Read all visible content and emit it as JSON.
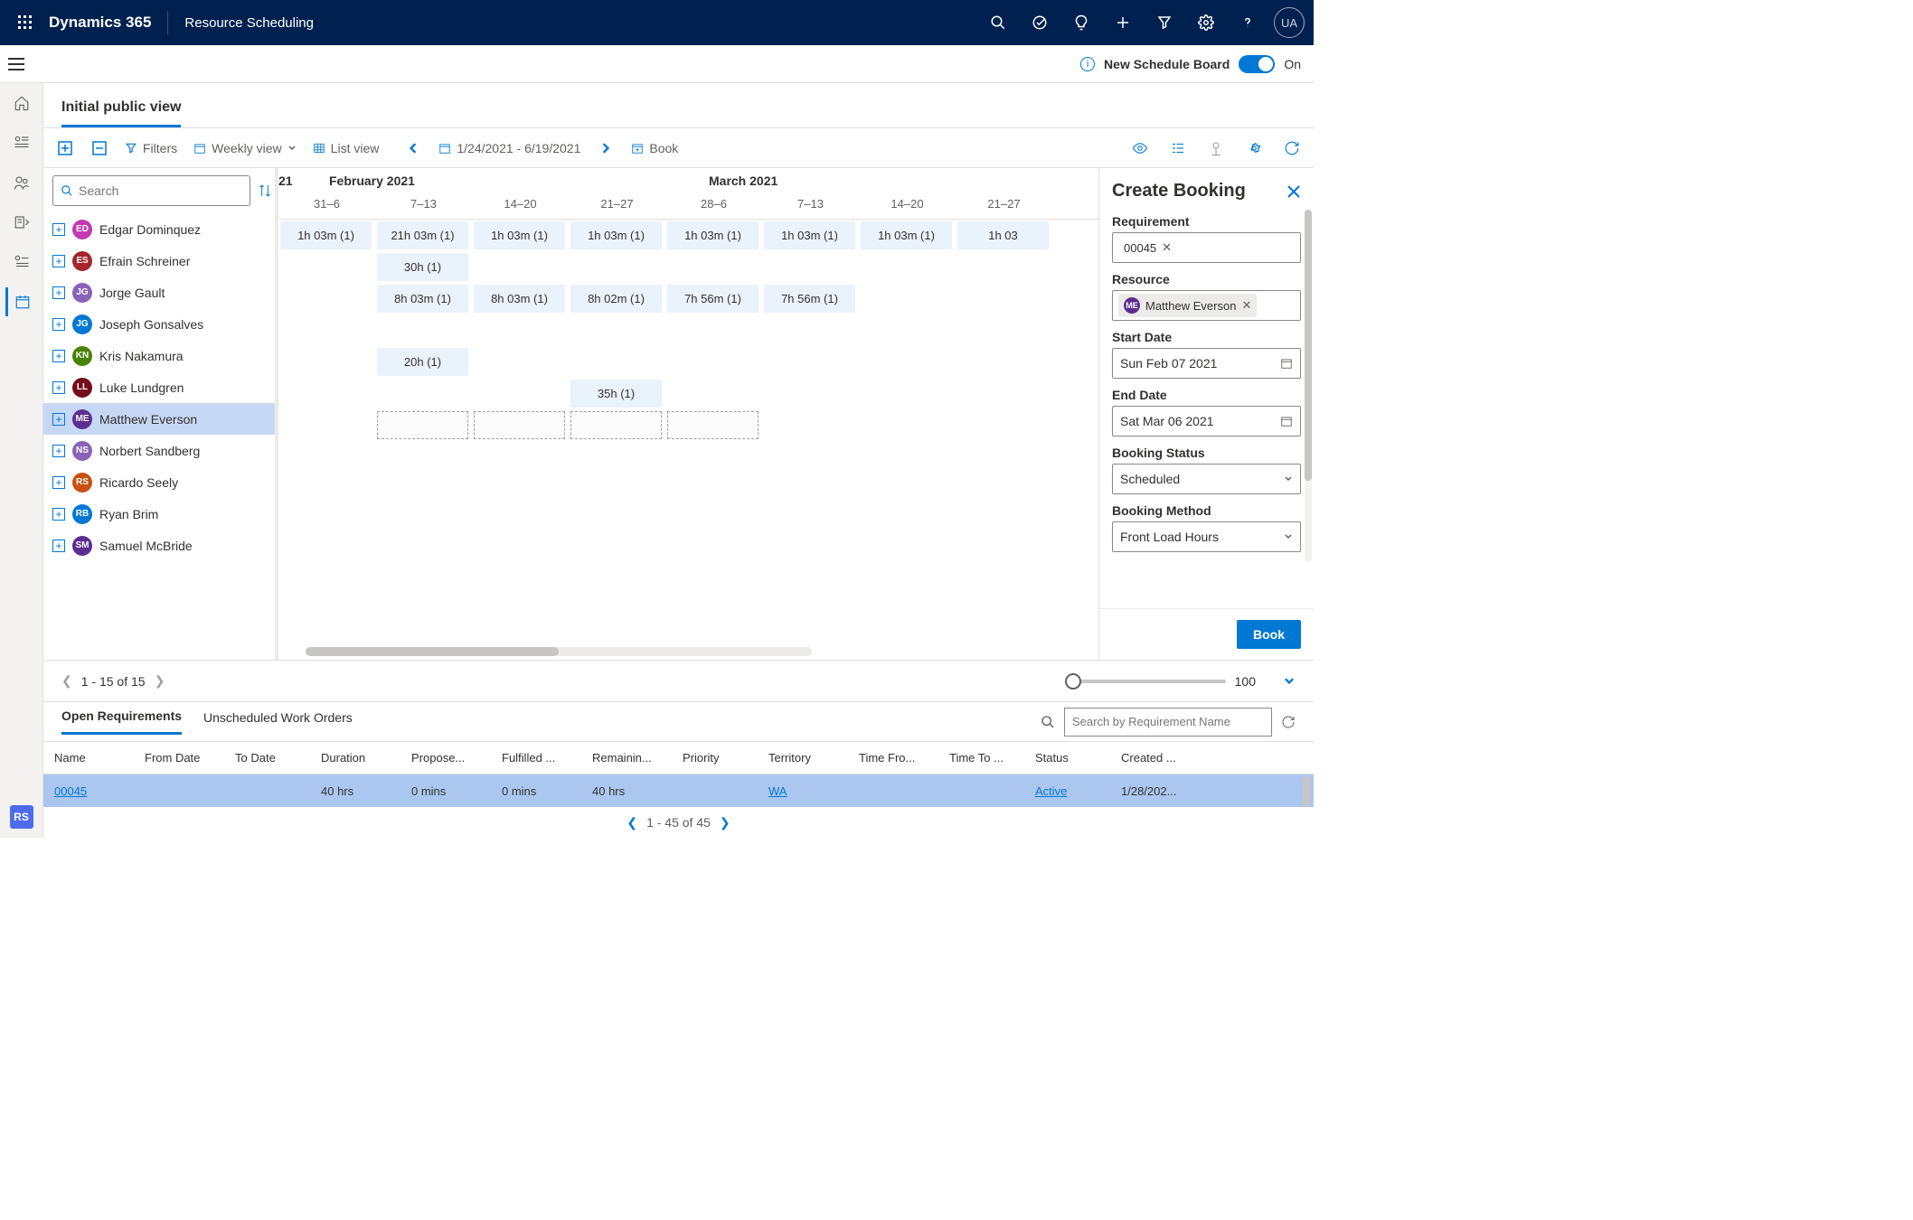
{
  "header": {
    "brand": "Dynamics 365",
    "module": "Resource Scheduling",
    "avatar": "UA"
  },
  "info_row": {
    "label": "New Schedule Board",
    "toggle_state": "On"
  },
  "view_tab": "Initial public view",
  "toolbar": {
    "filters": "Filters",
    "view_mode": "Weekly view",
    "list_view": "List view",
    "date_range": "1/24/2021 - 6/19/2021",
    "book": "Book"
  },
  "search": {
    "placeholder": "Search"
  },
  "resources": [
    {
      "initials": "ED",
      "color": "#c239b3",
      "name": "Edgar Dominquez"
    },
    {
      "initials": "ES",
      "color": "#a4262c",
      "name": "Efrain Schreiner"
    },
    {
      "initials": "JG",
      "color": "#8764b8",
      "name": "Jorge Gault"
    },
    {
      "initials": "JG",
      "color": "#0078d4",
      "name": "Joseph Gonsalves"
    },
    {
      "initials": "KN",
      "color": "#498205",
      "name": "Kris Nakamura"
    },
    {
      "initials": "LL",
      "color": "#750b1c",
      "name": "Luke Lundgren"
    },
    {
      "initials": "ME",
      "color": "#5c2e91",
      "name": "Matthew Everson",
      "selected": true
    },
    {
      "initials": "NS",
      "color": "#8764b8",
      "name": "Norbert Sandberg"
    },
    {
      "initials": "RS",
      "color": "#ca5010",
      "name": "Ricardo Seely"
    },
    {
      "initials": "RB",
      "color": "#0078d4",
      "name": "Ryan Brim"
    },
    {
      "initials": "SM",
      "color": "#5c2e91",
      "name": "Samuel McBride"
    }
  ],
  "timeline": {
    "prev_label": "21",
    "month1": "February 2021",
    "month2": "March 2021",
    "weeks": [
      "31–6",
      "7–13",
      "14–20",
      "21–27",
      "28–6",
      "7–13",
      "14–20",
      "21–27"
    ],
    "rows": [
      {
        "cells": [
          {
            "c": 0,
            "t": "1h 03m (1)"
          },
          {
            "c": 1,
            "t": "21h 03m (1)"
          },
          {
            "c": 2,
            "t": "1h 03m (1)"
          },
          {
            "c": 3,
            "t": "1h 03m (1)"
          },
          {
            "c": 4,
            "t": "1h 03m (1)"
          },
          {
            "c": 5,
            "t": "1h 03m (1)"
          },
          {
            "c": 6,
            "t": "1h 03m (1)"
          },
          {
            "c": 7,
            "t": "1h 03"
          }
        ]
      },
      {
        "cells": [
          {
            "c": 1,
            "t": "30h (1)"
          }
        ]
      },
      {
        "cells": [
          {
            "c": 1,
            "t": "8h 03m (1)"
          },
          {
            "c": 2,
            "t": "8h 03m (1)"
          },
          {
            "c": 3,
            "t": "8h 02m (1)"
          },
          {
            "c": 4,
            "t": "7h 56m (1)"
          },
          {
            "c": 5,
            "t": "7h 56m (1)"
          }
        ]
      },
      {
        "cells": []
      },
      {
        "cells": [
          {
            "c": 1,
            "t": "20h (1)"
          }
        ]
      },
      {
        "cells": [
          {
            "c": 3,
            "t": "35h (1)"
          }
        ]
      },
      {
        "cells": [],
        "dashed": true
      },
      {
        "cells": []
      },
      {
        "cells": []
      },
      {
        "cells": []
      },
      {
        "cells": []
      }
    ]
  },
  "panel": {
    "title": "Create Booking",
    "req_lbl": "Requirement",
    "req_val": "00045",
    "res_lbl": "Resource",
    "res_val": "Matthew Everson",
    "res_initials": "ME",
    "sd_lbl": "Start Date",
    "sd_val": "Sun Feb 07 2021",
    "ed_lbl": "End Date",
    "ed_val": "Sat Mar 06 2021",
    "bs_lbl": "Booking Status",
    "bs_val": "Scheduled",
    "bm_lbl": "Booking Method",
    "bm_val": "Front Load Hours",
    "book_btn": "Book"
  },
  "pager": {
    "text": "1 - 15 of 15",
    "zoom": "100"
  },
  "btabs": {
    "open": "Open Requirements",
    "unsched": "Unscheduled Work Orders",
    "filter_ph": "Search by Requirement Name"
  },
  "grid": {
    "cols": [
      "Name",
      "From Date",
      "To Date",
      "Duration",
      "Propose...",
      "Fulfilled ...",
      "Remainin...",
      "Priority",
      "Territory",
      "Time Fro...",
      "Time To ...",
      "Status",
      "Created ..."
    ],
    "row": {
      "name": "00045",
      "duration": "40 hrs",
      "proposed": "0 mins",
      "fulfilled": "0 mins",
      "remaining": "40 hrs",
      "territory": "WA",
      "status": "Active",
      "created": "1/28/202..."
    },
    "pager": "1 - 45 of 45"
  }
}
